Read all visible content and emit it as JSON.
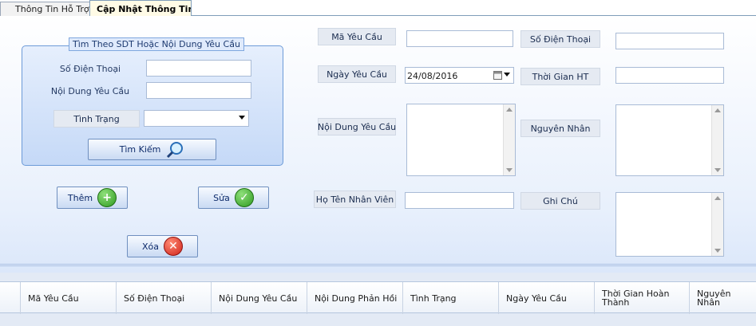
{
  "tabs": [
    {
      "label": "Thông Tin Hỗ Trợ"
    },
    {
      "label": "Cập Nhật Thông Tin"
    }
  ],
  "search": {
    "group_title": "Tìm Theo SDT Hoặc Nội Dung Yêu Cầu",
    "phone_label": "Số Điện Thoại",
    "phone_value": "",
    "content_label": "Nội Dung Yêu Cầu",
    "content_value": "",
    "status_label": "Tình Trạng",
    "status_value": "",
    "search_button": "Tìm Kiếm"
  },
  "actions": {
    "add": "Thêm",
    "edit": "Sửa",
    "delete": "Xóa"
  },
  "form": {
    "request_id_label": "Mã Yêu Cầu",
    "request_id_value": "",
    "phone_label": "Số Điện Thoại",
    "phone_value": "",
    "date_label": "Ngày Yêu Cầu",
    "date_value": "24/08/2016",
    "completion_label": "Thời Gian HT",
    "completion_value": "",
    "content_label": "Nội Dung Yêu Cầu",
    "reason_label": "Nguyên Nhân",
    "staff_label": "Họ Tên Nhân Viên",
    "staff_value": "",
    "note_label": "Ghi Chú"
  },
  "grid": {
    "columns": [
      "Mã Yêu Cầu",
      "Số Điện Thoại",
      "Nội Dung Yêu Cầu",
      "Nội Dung Phản Hồi",
      "Tình Trạng",
      "Ngày Yêu Cầu",
      "Thời Gian Hoàn Thành",
      "Nguyên Nhân"
    ]
  },
  "colors": {
    "accent_border": "#6d9bd8",
    "panel_bottom": "#dbe7fa"
  }
}
